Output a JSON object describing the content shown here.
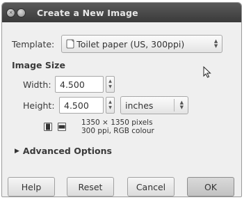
{
  "window": {
    "title": "Create a New Image",
    "close_glyph": "×",
    "minimize_glyph": ""
  },
  "template": {
    "label": "Template:",
    "value": "Toilet paper (US, 300ppi)",
    "icon": "page-icon"
  },
  "image_size": {
    "heading": "Image Size",
    "width_label": "Width:",
    "width_value": "4.500",
    "height_label": "Height:",
    "height_value": "4.500",
    "unit": "inches",
    "info_line1": "1350 × 1350 pixels",
    "info_line2": "300 ppi, RGB colour",
    "portrait_icon": "portrait-orientation-icon",
    "landscape_icon": "landscape-orientation-icon"
  },
  "advanced": {
    "expander_glyph": "▶",
    "label": "Advanced Options"
  },
  "buttons": {
    "help": "Help",
    "reset": "Reset",
    "cancel": "Cancel",
    "ok": "OK"
  },
  "spin_up": "▲",
  "spin_down": "▼"
}
